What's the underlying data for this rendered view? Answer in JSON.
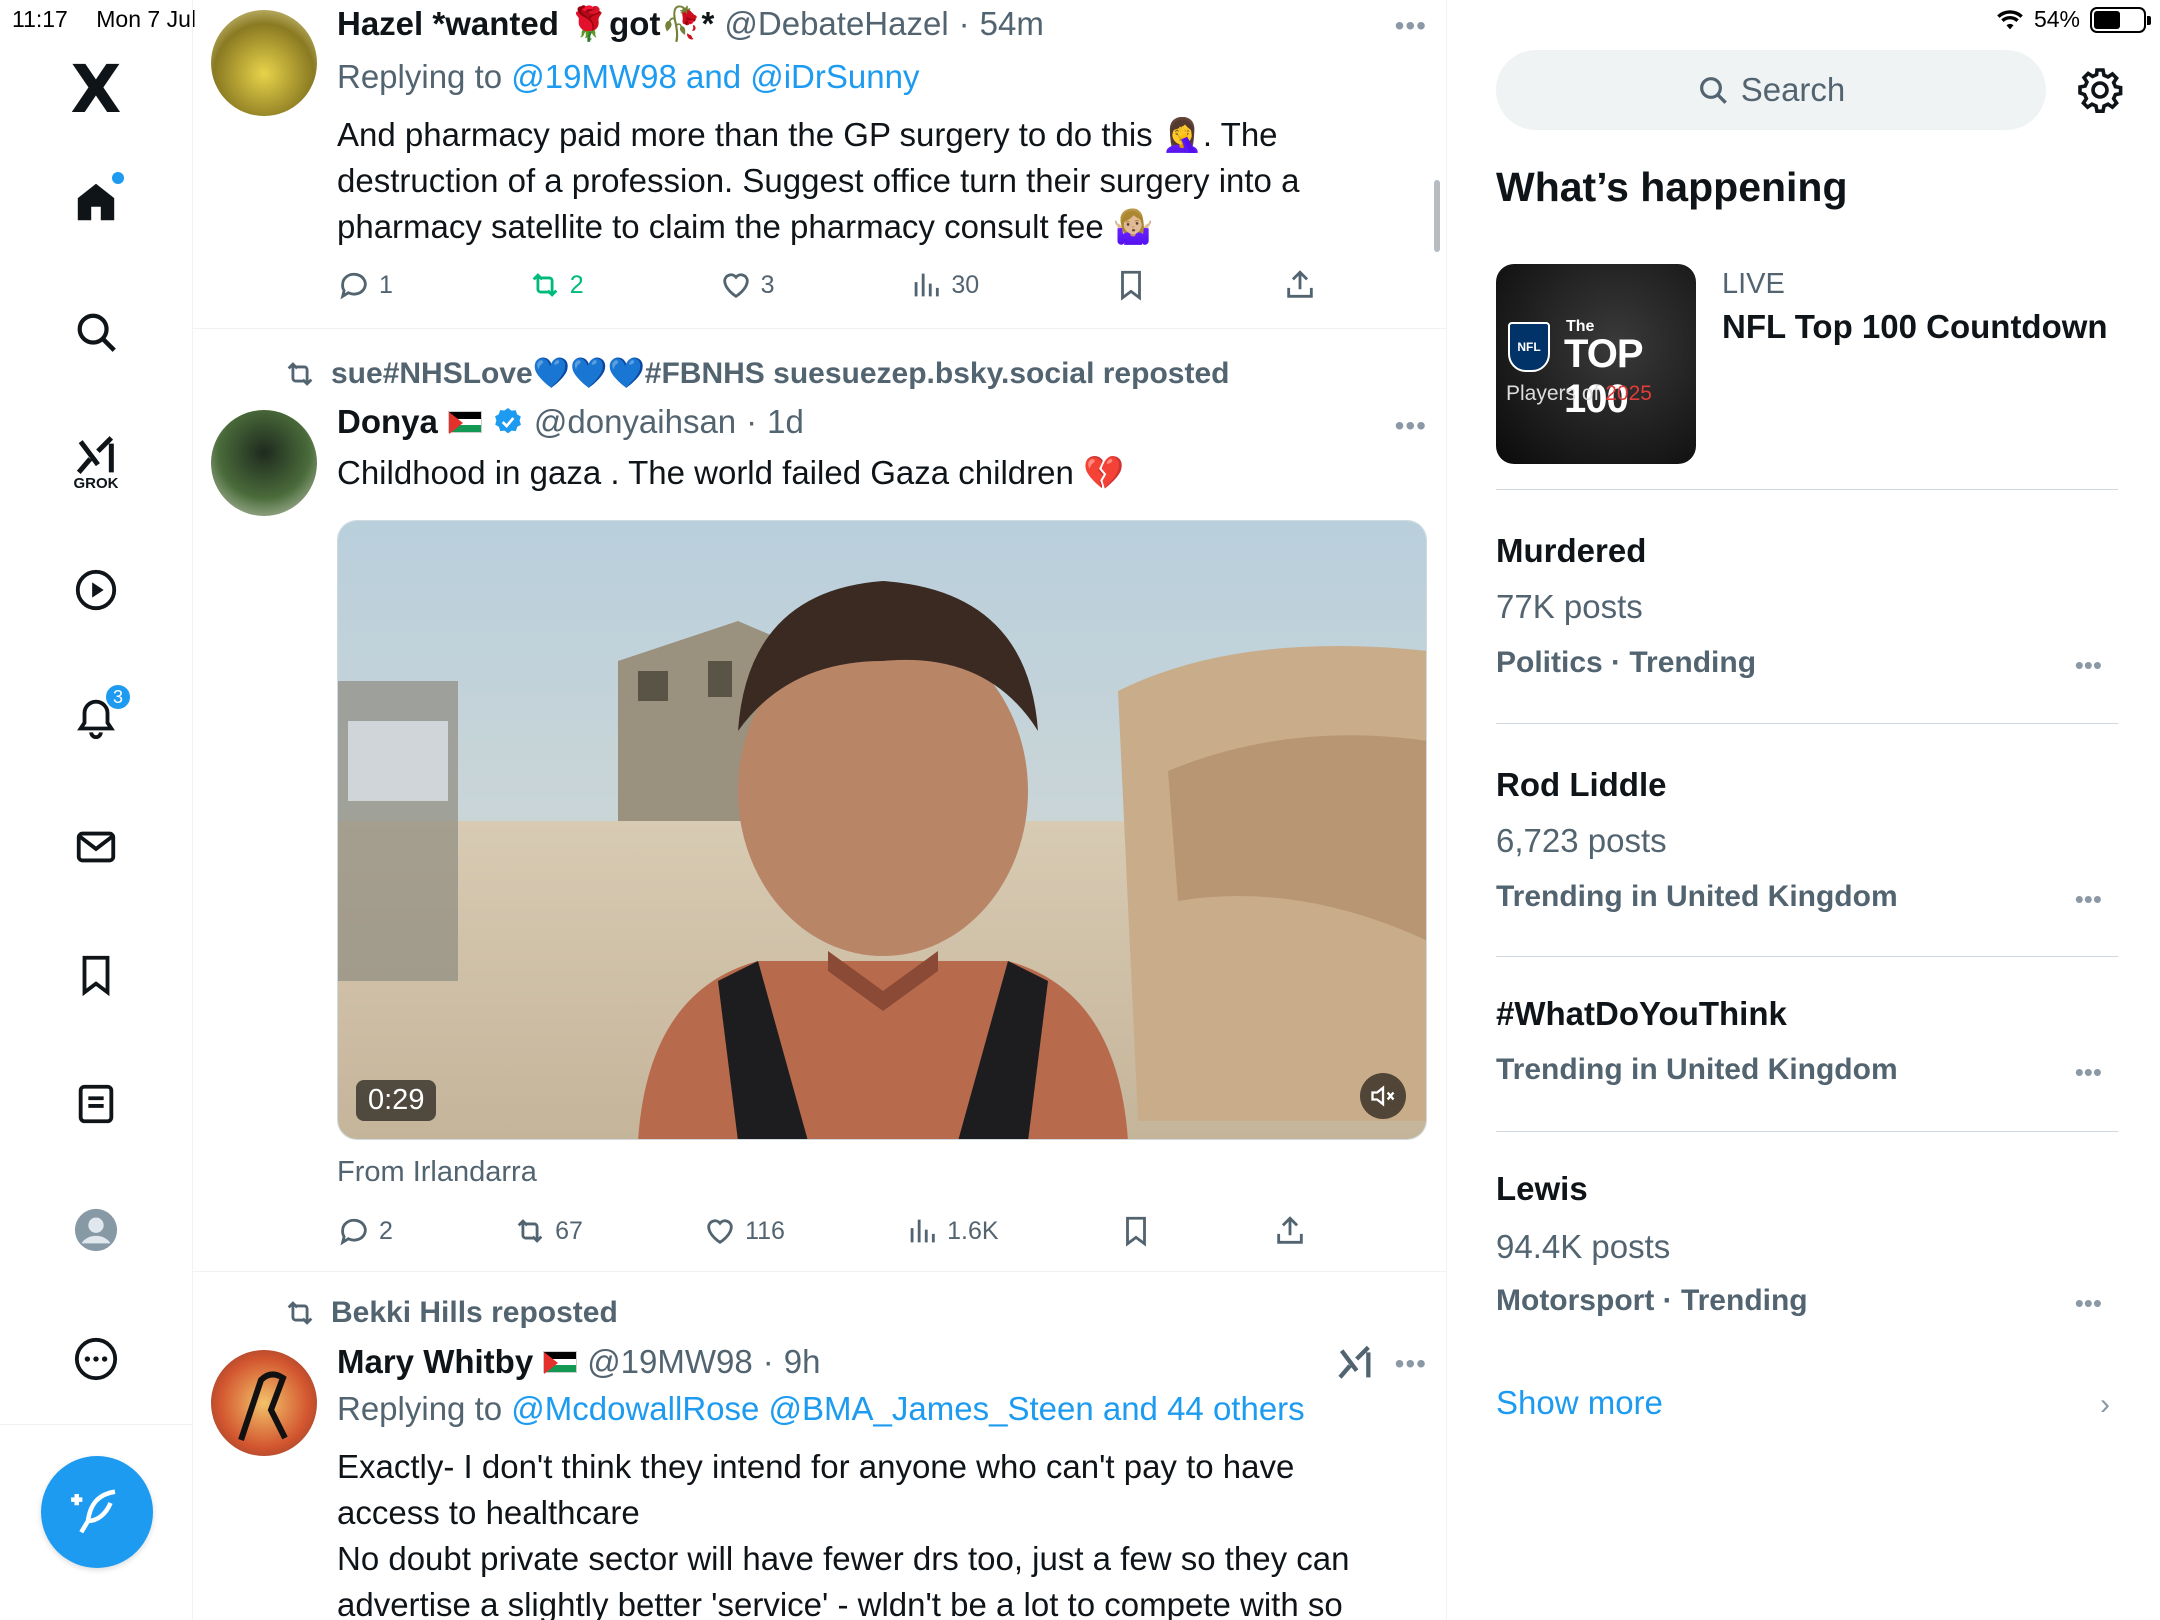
{
  "status": {
    "time": "11:17",
    "date": "Mon 7 Jul",
    "battery": "54%",
    "battery_level": 0.54
  },
  "nav": {
    "logo": "X",
    "grok_label": "GROK",
    "notifications_count": "3"
  },
  "tweets": [
    {
      "name": "Hazel *wanted 🌹got🥀*",
      "handle": "@DebateHazel",
      "time": "54m",
      "reply_prefix": "Replying to",
      "reply_to": "@19MW98 and @iDrSunny",
      "text": "And pharmacy paid more than the  GP surgery to do this 🤦‍♀️. The destruction of a profession.  Suggest office  turn their surgery into a pharmacy satellite to claim the pharmacy consult fee 🤷🏼‍♀️",
      "replies": "1",
      "reposts": "2",
      "likes": "3",
      "views": "30"
    },
    {
      "reposted_by": "sue#NHSLove💙💙💙#FBNHS suesuezep.bsky.social reposted",
      "name": "Donya",
      "handle": "@donyaihsan",
      "time": "1d",
      "text": "Childhood in gaza . The world failed Gaza children 💔",
      "video_time": "0:29",
      "from": "From Irlandarra",
      "replies": "2",
      "reposts": "67",
      "likes": "116",
      "views": "1.6K"
    },
    {
      "reposted_by": "Bekki Hills reposted",
      "name": "Mary Whitby",
      "handle": "@19MW98",
      "time": "9h",
      "reply_prefix": "Replying to",
      "reply_to": "@McdowallRose @BMA_James_Steen and 44 others",
      "text_1": "Exactly- I don't think they intend for anyone who can't pay to have access to healthcare",
      "text_2": "No doubt private sector will have fewer drs too, just a few so they can advertise a slightly better 'service' - wldn't be a lot to compete with so"
    }
  ],
  "right": {
    "search_placeholder": "Search",
    "whats_happening": "What’s happening",
    "feature": {
      "label": "LIVE",
      "title": "NFL Top 100 Countdown",
      "thumb_the": "The",
      "thumb_top": "TOP 100",
      "thumb_players": "Players of ",
      "thumb_year": "2025",
      "thumb_nfl": "NFL"
    },
    "trends": [
      {
        "title": "Murdered",
        "posts": "77K posts",
        "context": "Politics · Trending"
      },
      {
        "title": "Rod Liddle",
        "posts": "6,723 posts",
        "context": "Trending in United Kingdom"
      },
      {
        "title": "#WhatDoYouThink",
        "posts": "",
        "context": "Trending in United Kingdom"
      },
      {
        "title": "Lewis",
        "posts": "94.4K posts",
        "context": "Motorsport · Trending"
      }
    ],
    "show_more": "Show more"
  }
}
